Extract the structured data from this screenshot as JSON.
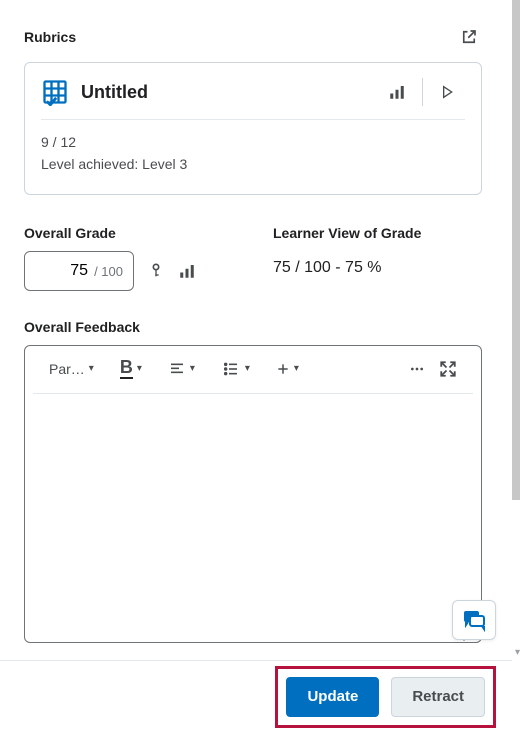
{
  "header": {
    "rubrics_label": "Rubrics"
  },
  "rubric_card": {
    "title": "Untitled",
    "score": "9 / 12",
    "level_line": "Level achieved: Level 3"
  },
  "overall_grade": {
    "label": "Overall Grade",
    "value": "75",
    "max_display": "/ 100"
  },
  "learner_view": {
    "label": "Learner View of Grade",
    "value": "75 / 100 - 75 %"
  },
  "feedback": {
    "label": "Overall Feedback",
    "paragraph_label": "Par…"
  },
  "footer": {
    "update": "Update",
    "retract": "Retract"
  }
}
